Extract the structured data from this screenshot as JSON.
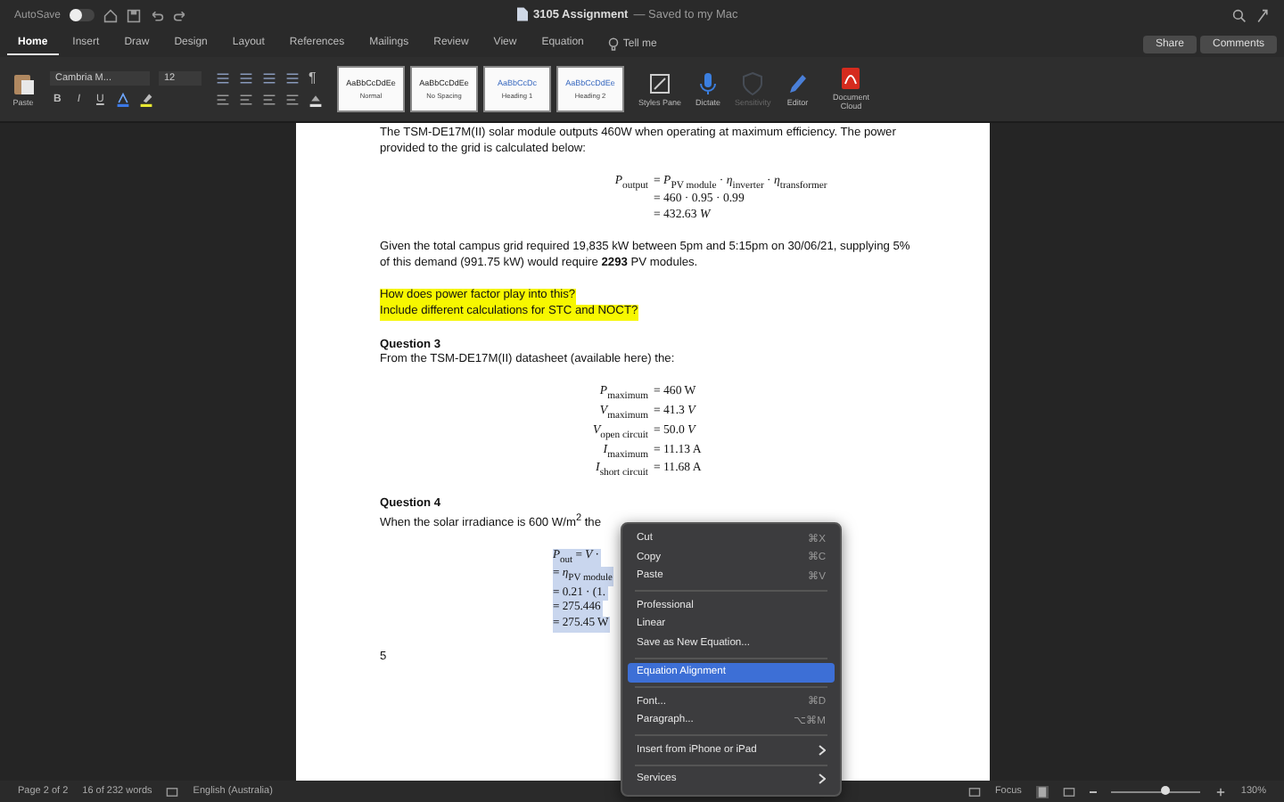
{
  "title_bar": {
    "autosave_label": "AutoSave",
    "autosave_on": false,
    "document_title": "3105 Assignment",
    "save_status": "— Saved to my Mac"
  },
  "tabs": [
    {
      "label": "Home",
      "selected": true
    },
    {
      "label": "Insert",
      "selected": false
    },
    {
      "label": "Draw",
      "selected": false
    },
    {
      "label": "Design",
      "selected": false
    },
    {
      "label": "Layout",
      "selected": false
    },
    {
      "label": "References",
      "selected": false
    },
    {
      "label": "Mailings",
      "selected": false
    },
    {
      "label": "Review",
      "selected": false
    },
    {
      "label": "View",
      "selected": false
    },
    {
      "label": "Equation",
      "selected": false
    }
  ],
  "tell_me": "Tell me",
  "share_button": "Share",
  "comments_button": "Comments",
  "ribbon": {
    "paste_label": "Paste",
    "font_name": "Cambria M...",
    "font_size": "12",
    "format_buttons": [
      "B",
      "I",
      "U"
    ],
    "pilcrow": "¶",
    "styles": [
      {
        "sample": "AaBbCcDdEe",
        "name": "Normal",
        "kind": "body"
      },
      {
        "sample": "AaBbCcDdEe",
        "name": "No Spacing",
        "kind": "body"
      },
      {
        "sample": "AaBbCcDc",
        "name": "Heading 1",
        "kind": "heading"
      },
      {
        "sample": "AaBbCcDdEe",
        "name": "Heading 2",
        "kind": "heading"
      }
    ],
    "big_buttons": [
      {
        "label": "Styles Pane",
        "kind": "styles",
        "disabled": false
      },
      {
        "label": "Dictate",
        "kind": "mic",
        "disabled": false
      },
      {
        "label": "Sensitivity",
        "kind": "shield",
        "disabled": true
      },
      {
        "label": "Editor",
        "kind": "pen",
        "disabled": false
      },
      {
        "label": "Document Cloud",
        "kind": "pdf",
        "disabled": false
      }
    ]
  },
  "document": {
    "blocks": [
      {
        "kind": "paragraph",
        "text": "The TSM-DE17M(II) solar module outputs 460W when operating at maximum efficiency. The power provided to the grid is calculated below:"
      },
      {
        "kind": "equation",
        "rows": [
          {
            "lhs": "*P*$_{output}$",
            "rhs": "= *P*$_{PV module}$ · *η*$_{inverter}$ · *η*$_{transformer}$"
          },
          {
            "lhs": "",
            "rhs": "= 460 · 0.95 · 0.99"
          },
          {
            "lhs": "",
            "rhs": "= 432.63 *W*"
          }
        ]
      },
      {
        "kind": "paragraph",
        "text": "Given the total campus grid required 19,835 kW between 5pm and 5:15pm on 30/06/21, supplying 5% of this demand (991.75 kW) would require **2293** PV modules."
      },
      {
        "kind": "highlight",
        "lines": [
          "How does power factor play into this?",
          "Include different calculations for STC and NOCT?"
        ]
      },
      {
        "kind": "heading",
        "text": "Question 3"
      },
      {
        "kind": "paragraph",
        "text": "From the TSM-DE17M(II) datasheet (available here) the:"
      },
      {
        "kind": "equation",
        "rows": [
          {
            "lhs": "*P*$_{maximum}$",
            "rhs": "=  460 W"
          },
          {
            "lhs": "*V*$_{maximum}$",
            "rhs": "= 41.3 *V*"
          },
          {
            "lhs": "*V*$_{open circuit}$",
            "rhs": "= 50.0 *V*"
          },
          {
            "lhs": "*I*$_{maximum}$",
            "rhs": "= 11.13 A"
          },
          {
            "lhs": "*I*$_{short circuit}$",
            "rhs": "= 11.68 A"
          }
        ]
      },
      {
        "kind": "heading",
        "text": "Question 4"
      },
      {
        "kind": "paragraph",
        "text": "When the solar irradiance is 600 W/m$^{2}$ the"
      },
      {
        "kind": "selected_equation",
        "lines": [
          "*P*$_{out}$ = *V* ·",
          "= *η*$_{PV module}$",
          "= 0.21 · (1.",
          "= 275.446",
          "= 275.45 W"
        ]
      },
      {
        "kind": "paragraph",
        "text": "5"
      }
    ]
  },
  "context_menu": [
    {
      "kind": "item",
      "label": "Cut",
      "shortcut": "⌘X",
      "selected": false,
      "submenu": false
    },
    {
      "kind": "item",
      "label": "Copy",
      "shortcut": "⌘C",
      "selected": false,
      "submenu": false
    },
    {
      "kind": "item",
      "label": "Paste",
      "shortcut": "⌘V",
      "selected": false,
      "submenu": false
    },
    {
      "kind": "separator"
    },
    {
      "kind": "item",
      "label": "Professional",
      "selected": false,
      "submenu": false
    },
    {
      "kind": "item",
      "label": "Linear",
      "selected": false,
      "submenu": false
    },
    {
      "kind": "item",
      "label": "Save as New Equation...",
      "selected": false,
      "submenu": false
    },
    {
      "kind": "separator"
    },
    {
      "kind": "item",
      "label": "Equation Alignment",
      "selected": true,
      "submenu": false
    },
    {
      "kind": "separator"
    },
    {
      "kind": "item",
      "label": "Font...",
      "shortcut": "⌘D",
      "selected": false,
      "submenu": false
    },
    {
      "kind": "item",
      "label": "Paragraph...",
      "shortcut": "⌥⌘M",
      "selected": false,
      "submenu": false
    },
    {
      "kind": "separator"
    },
    {
      "kind": "item",
      "label": "Insert from iPhone or iPad",
      "selected": false,
      "submenu": true
    },
    {
      "kind": "separator"
    },
    {
      "kind": "item",
      "label": "Services",
      "selected": false,
      "submenu": true
    }
  ],
  "status_bar": {
    "page": "Page 2 of 2",
    "words": "16 of 232 words",
    "language": "English (Australia)",
    "focus": "Focus",
    "zoom": {
      "level": 0.62
    },
    "zoom_percent": "130%"
  }
}
